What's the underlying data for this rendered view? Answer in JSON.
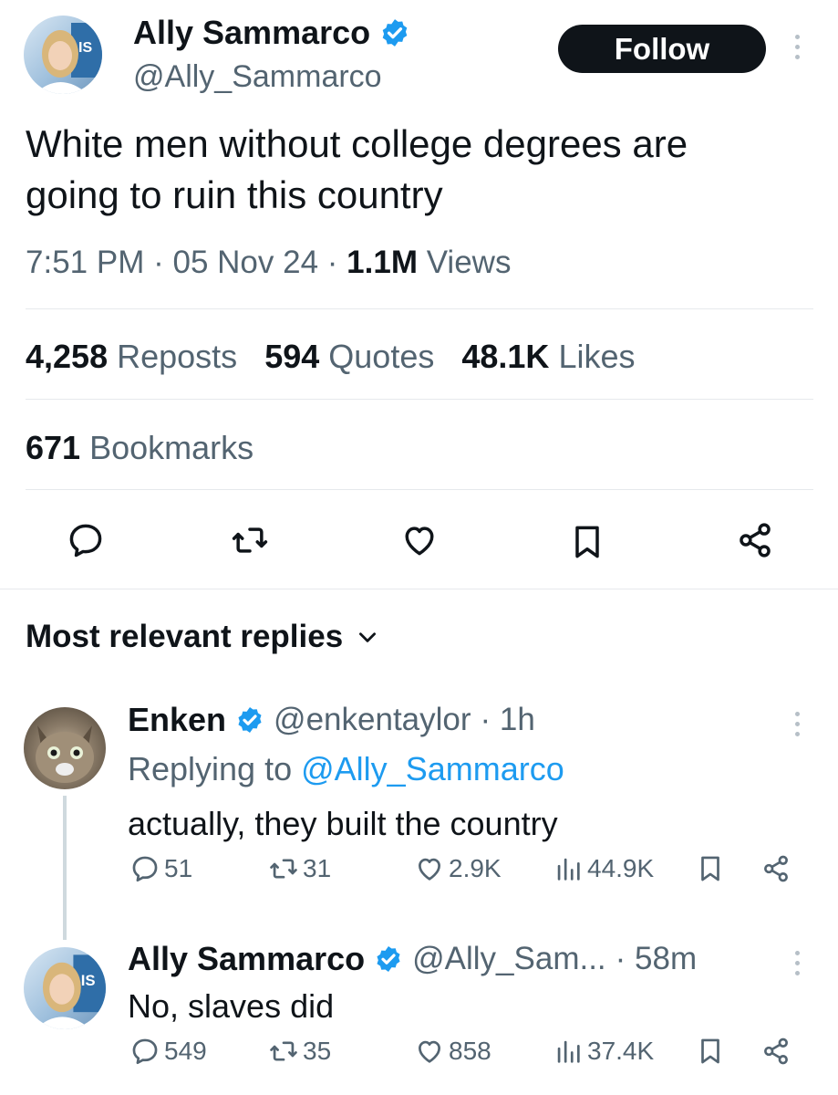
{
  "tweet": {
    "author_name": "Ally Sammarco",
    "author_handle": "@Ally_Sammarco",
    "follow_label": "Follow",
    "text_line1": "White men without college degrees are",
    "text_line2": "going to ruin this country",
    "time": "7:51 PM",
    "date": "05 Nov 24",
    "views_count": "1.1M",
    "views_label": "Views",
    "reposts_count": "4,258",
    "reposts_label": "Reposts",
    "quotes_count": "594",
    "quotes_label": "Quotes",
    "likes_count": "48.1K",
    "likes_label": "Likes",
    "bookmarks_count": "671",
    "bookmarks_label": "Bookmarks",
    "avatar_text": "IS Z"
  },
  "replies_header": {
    "label": "Most relevant replies"
  },
  "replies": [
    {
      "name": "Enken",
      "handle": "@enkentaylor",
      "time": "· 1h",
      "replying_prefix": "Replying to",
      "replying_to": "@Ally_Sammarco",
      "text": "actually, they built the country",
      "comments": "51",
      "reposts": "31",
      "likes": "2.9K",
      "views": "44.9K"
    },
    {
      "name": "Ally Sammarco",
      "handle": "@Ally_Sam...",
      "time": "· 58m",
      "text": "No, slaves did",
      "comments": "549",
      "reposts": "35",
      "likes": "858",
      "views": "37.4K"
    }
  ],
  "colors": {
    "accent": "#1d9bf0",
    "text": "#0f1419",
    "muted": "#536471",
    "divider": "#e6e9ec"
  },
  "icons": [
    "verified-badge-icon",
    "more-icon",
    "reply-icon",
    "repost-icon",
    "like-icon",
    "bookmark-icon",
    "share-icon",
    "chevron-down-icon",
    "views-icon"
  ]
}
